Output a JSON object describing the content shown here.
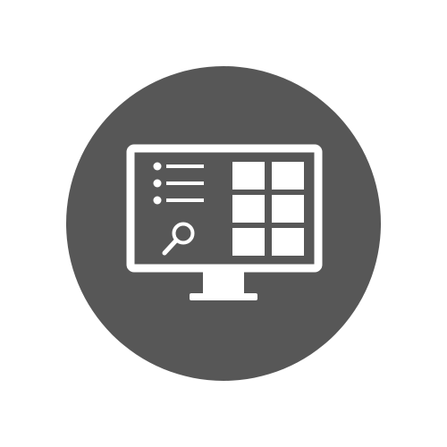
{
  "icon": {
    "name": "computer-monitor-dashboard-icon",
    "background_color": "#ffffff",
    "circle_color": "#575757",
    "glyph_color": "#ffffff",
    "parts": [
      "monitor-screen-icon",
      "bullet-list-icon",
      "search-icon",
      "grid-tiles-icon",
      "monitor-stand-icon"
    ],
    "list_items": 3,
    "grid_tiles": 6
  }
}
